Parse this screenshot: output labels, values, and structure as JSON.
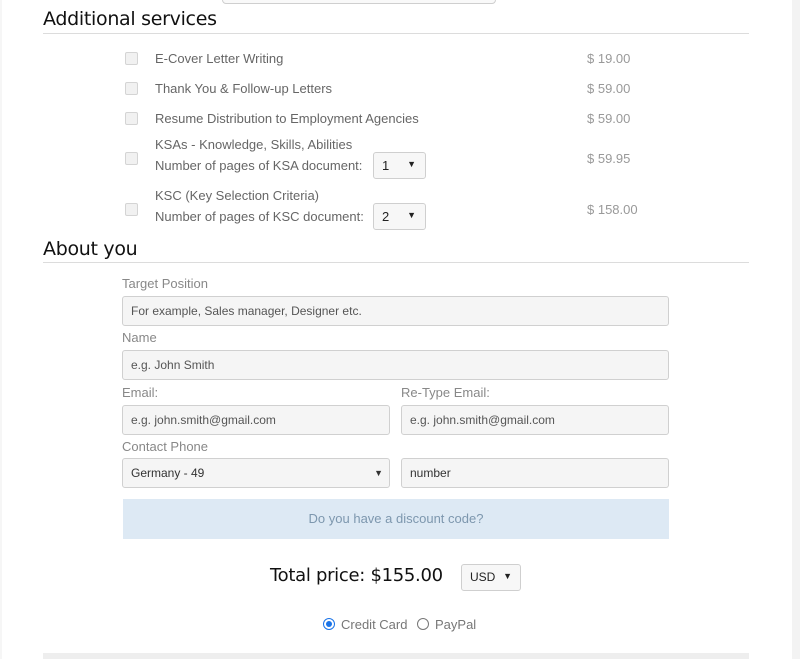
{
  "additional_services": {
    "title": "Additional services",
    "items": [
      {
        "label": "E-Cover Letter Writing",
        "price": "$ 19.00",
        "checked": false
      },
      {
        "label": "Thank You & Follow-up Letters",
        "price": "$ 59.00",
        "checked": false
      },
      {
        "label": "Resume Distribution to Employment Agencies",
        "price": "$ 59.00",
        "checked": false
      },
      {
        "label": "KSAs - Knowledge, Skills, Abilities",
        "sublabel": "Number of pages of KSA document:",
        "pages": "1",
        "price": "$ 59.95",
        "checked": false
      },
      {
        "label": "KSC (Key Selection Criteria)",
        "sublabel": "Number of pages of KSC document:",
        "pages": "2",
        "price": "$ 158.00",
        "checked": false
      }
    ]
  },
  "about_you": {
    "title": "About you",
    "target_position": {
      "label": "Target Position",
      "placeholder": "For example, Sales manager, Designer etc."
    },
    "name": {
      "label": "Name",
      "placeholder": "e.g. John Smith"
    },
    "email": {
      "label": "Email:",
      "placeholder": "e.g. john.smith@gmail.com"
    },
    "retype_email": {
      "label": "Re-Type Email:",
      "placeholder": "e.g. john.smith@gmail.com"
    },
    "phone": {
      "label": "Contact Phone",
      "country": "Germany - 49",
      "number_placeholder": "number"
    },
    "discount_text": "Do you have a discount code?"
  },
  "total": {
    "label": "Total price: $155.00",
    "currency": "USD"
  },
  "payment": {
    "options": [
      {
        "label": "Credit Card",
        "selected": true
      },
      {
        "label": "PayPal",
        "selected": false
      }
    ]
  },
  "icons": {
    "dropdown": "▼"
  }
}
